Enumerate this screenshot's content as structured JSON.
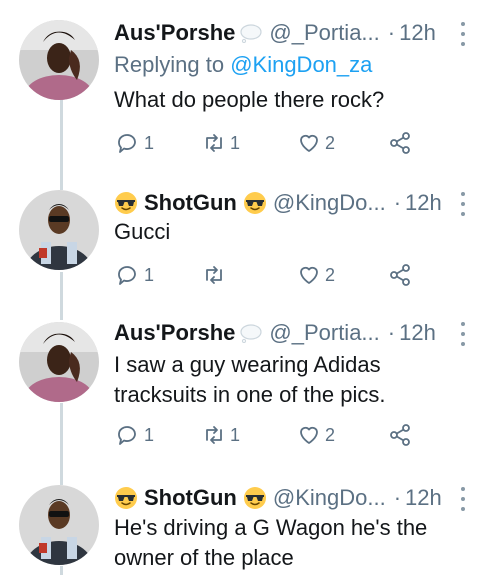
{
  "tweets": [
    {
      "name": "Aus'Porshe",
      "handle": "@_Portia...",
      "dot": "·",
      "time": "12h",
      "replying_prefix": "Replying to ",
      "replying_to": "@KingDon_za",
      "text": "What do people there rock?",
      "reply_count": "1",
      "retweet_count": "1",
      "like_count": "2",
      "avatar_icon": "woman-avatar",
      "name_suffix_icon": "speech-bubble-icon"
    },
    {
      "name": "ShotGun",
      "handle": "@KingDo...",
      "dot": "·",
      "time": "12h",
      "text": "Gucci",
      "reply_count": "1",
      "retweet_count": "",
      "like_count": "2",
      "avatar_icon": "man-avatar",
      "name_emoji": "sunglasses-emoji"
    },
    {
      "name": "Aus'Porshe",
      "handle": "@_Portia...",
      "dot": "·",
      "time": "12h",
      "text": "I saw a guy wearing Adidas tracksuits in one of the pics.",
      "reply_count": "1",
      "retweet_count": "1",
      "like_count": "2",
      "avatar_icon": "woman-avatar",
      "name_suffix_icon": "speech-bubble-icon"
    },
    {
      "name": "ShotGun",
      "handle": "@KingDo...",
      "dot": "·",
      "time": "12h",
      "text": "He's driving a G Wagon he's the owner of the place",
      "avatar_icon": "man-avatar",
      "name_emoji": "sunglasses-emoji"
    }
  ],
  "colors": {
    "text": "#14171a",
    "muted": "#5b7083",
    "link": "#1da1f2",
    "thread": "#cfd9de"
  }
}
